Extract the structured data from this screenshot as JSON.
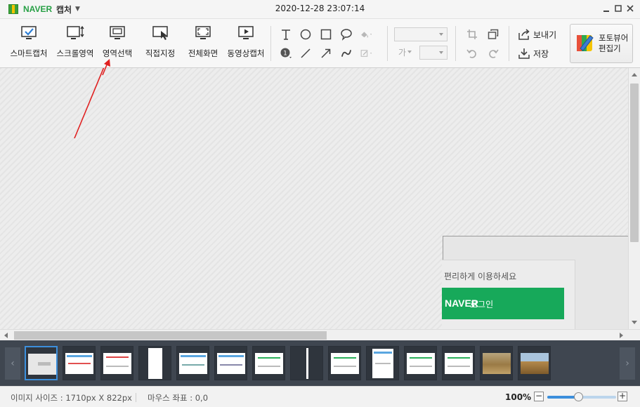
{
  "app": {
    "brand": "NAVER",
    "name": "캡처",
    "title": "2020-12-28 23:07:14"
  },
  "window_controls": [
    "minimize",
    "maximize",
    "close"
  ],
  "capture_modes": [
    {
      "label": "스마트캡처",
      "icon": "smart-capture-icon"
    },
    {
      "label": "스크롤영역",
      "icon": "scroll-capture-icon"
    },
    {
      "label": "영역선택",
      "icon": "region-select-icon"
    },
    {
      "label": "직접지정",
      "icon": "manual-select-icon"
    },
    {
      "label": "전체화면",
      "icon": "fullscreen-capture-icon"
    },
    {
      "label": "동영상캡처",
      "icon": "video-capture-icon"
    }
  ],
  "draw_tools": [
    "text-tool-icon",
    "ellipse-tool-icon",
    "rectangle-tool-icon",
    "speech-bubble-icon",
    "fill-color-icon",
    "number-marker-icon",
    "line-tool-icon",
    "arrow-tool-icon",
    "freehand-tool-icon",
    "pen-color-icon"
  ],
  "font": {
    "sample": "가",
    "font_name": "",
    "font_size": ""
  },
  "edit_tools": [
    "crop-icon",
    "copy-icon",
    "undo-icon",
    "redo-icon"
  ],
  "output": {
    "send_label": "보내기",
    "save_label": "저장"
  },
  "photoviewer": {
    "label": "포토뷰어 편집기"
  },
  "canvas": {
    "captured_note": "편리하게 이용하세요",
    "login_brand": "NAVER",
    "login_text": "로그인"
  },
  "filmstrip": {
    "selected_index": 0,
    "count": 14
  },
  "status": {
    "image_size": "이미지 사이즈 : 1710px X 822px",
    "mouse_coord": "마우스 좌표 : 0,0",
    "zoom": "100%",
    "zoom_level": 0.45,
    "zoom_out": "−",
    "zoom_in": "+"
  },
  "colors": {
    "accent": "#3c8fdc",
    "naver_green": "#17a95a",
    "annotation_red": "#e02020"
  }
}
